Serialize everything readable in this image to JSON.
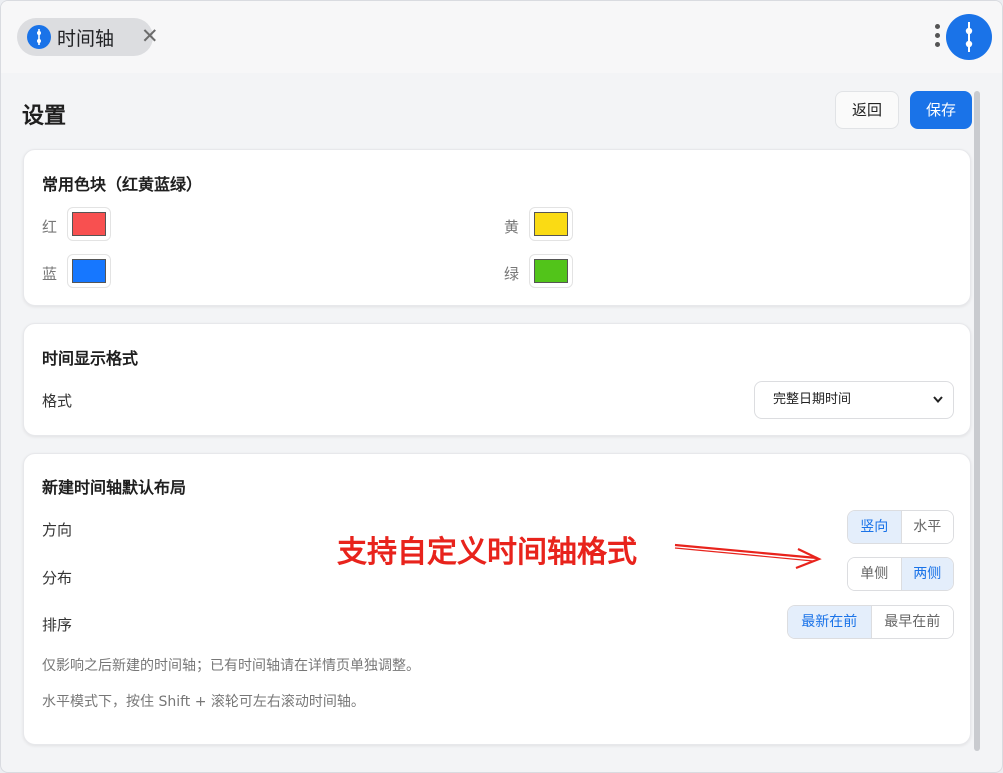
{
  "tab": {
    "title": "时间轴",
    "close_glyph": "✕"
  },
  "header": {
    "title": "设置",
    "back_label": "返回",
    "save_label": "保存"
  },
  "colors_section": {
    "title": "常用色块（红黄蓝绿）",
    "items": [
      {
        "label": "红",
        "color": "#f85050"
      },
      {
        "label": "黄",
        "color": "#fadb14"
      },
      {
        "label": "蓝",
        "color": "#1677ff"
      },
      {
        "label": "绿",
        "color": "#52c41a"
      }
    ]
  },
  "time_format_section": {
    "title": "时间显示格式",
    "format_label": "格式",
    "selected_format": "完整日期时间"
  },
  "layout_section": {
    "title": "新建时间轴默认布局",
    "direction_label": "方向",
    "direction_options": [
      "竖向",
      "水平"
    ],
    "direction_selected": "竖向",
    "distribution_label": "分布",
    "distribution_options": [
      "单侧",
      "两侧"
    ],
    "distribution_selected": "两侧",
    "order_label": "排序",
    "order_options": [
      "最新在前",
      "最早在前"
    ],
    "order_selected": "最新在前",
    "hint1": "仅影响之后新建的时间轴；已有时间轴请在详情页单独调整。",
    "hint2": "水平模式下，按住 Shift + 滚轮可左右滚动时间轴。"
  },
  "annotation": {
    "text": "支持自定义时间轴格式",
    "color": "#e8231c"
  },
  "theme": {
    "accent": "#1a73e8"
  }
}
